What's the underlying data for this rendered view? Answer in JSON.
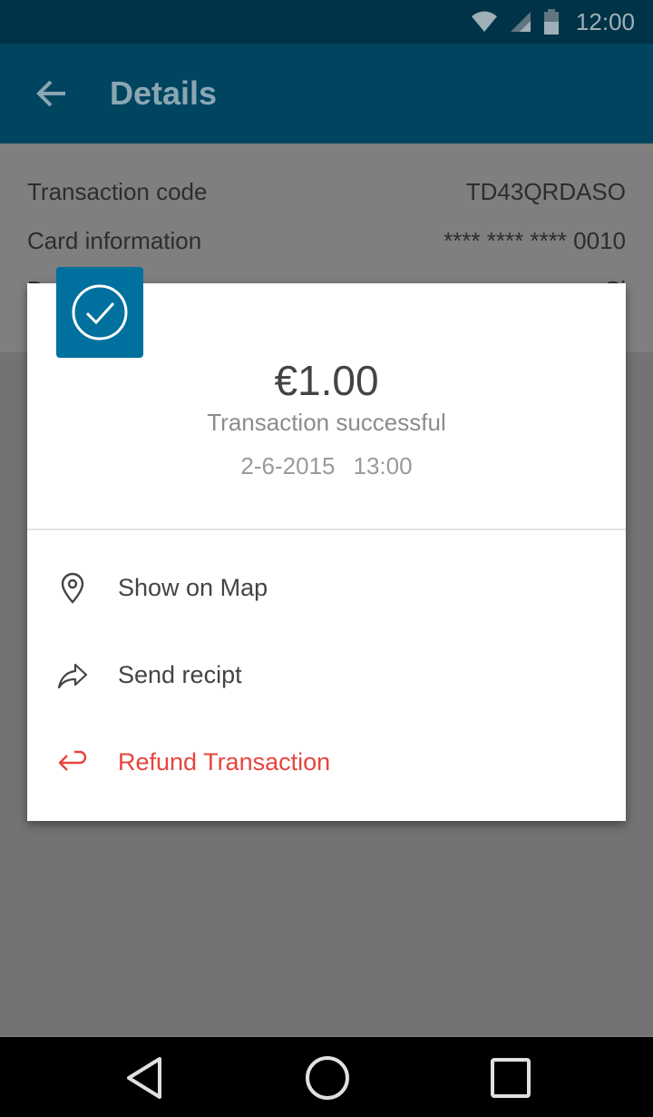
{
  "status_bar": {
    "time": "12:00",
    "icons": [
      "wifi-icon",
      "signal-icon",
      "battery-icon"
    ]
  },
  "app_bar": {
    "title": "Details",
    "back_icon": "arrow-back-icon"
  },
  "details": {
    "rows": [
      {
        "label": "Transaction code",
        "value": "TD43QRDASO"
      },
      {
        "label": "Card information",
        "value": "**** **** **** 0010"
      },
      {
        "label": "D",
        "value": "Si"
      }
    ]
  },
  "dialog": {
    "badge_icon": "check-circle-icon",
    "amount": "€1.00",
    "status": "Transaction successful",
    "date": "2-6-2015",
    "time": "13:00",
    "actions": [
      {
        "label": "Show on Map",
        "icon": "map-pin-icon"
      },
      {
        "label": "Send recipt",
        "icon": "share-arrow-icon"
      },
      {
        "label": "Refund Transaction",
        "icon": "refund-arrow-icon"
      }
    ]
  },
  "colors": {
    "status_bar": "#003347",
    "app_bar": "#004560",
    "badge": "#00709e",
    "refund": "#e8443e",
    "scrim": "#7a7a7a"
  },
  "nav_bar": {
    "icons": [
      "back-triangle-icon",
      "home-circle-icon",
      "recents-square-icon"
    ]
  }
}
